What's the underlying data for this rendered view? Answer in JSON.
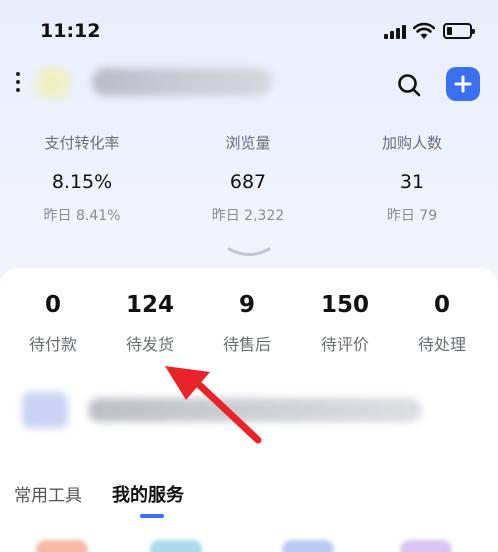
{
  "status_bar": {
    "time": "11:12"
  },
  "header": {
    "icons": [
      "menu-dots-icon",
      "search-icon",
      "plus-icon"
    ],
    "accent_color": "#3a6ff0"
  },
  "stats": [
    {
      "label": "支付转化率",
      "value": "8.15%",
      "yesterday": "昨日 8.41%"
    },
    {
      "label": "浏览量",
      "value": "687",
      "yesterday": "昨日 2,322"
    },
    {
      "label": "加购人数",
      "value": "31",
      "yesterday": "昨日 79"
    }
  ],
  "orders": [
    {
      "count": "0",
      "label": "待付款"
    },
    {
      "count": "124",
      "label": "待发货"
    },
    {
      "count": "9",
      "label": "待售后"
    },
    {
      "count": "150",
      "label": "待评价"
    },
    {
      "count": "0",
      "label": "待处理"
    }
  ],
  "tabs": {
    "common_tools": "常用工具",
    "my_services": "我的服务",
    "active": "my_services"
  },
  "annotation": {
    "arrow_color": "#e8242a",
    "points_to": "待发货"
  }
}
